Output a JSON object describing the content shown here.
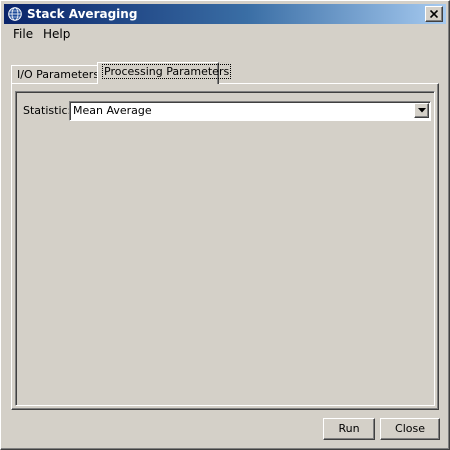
{
  "window": {
    "title": "Stack Averaging",
    "app_icon": "globe-icon",
    "close_icon": "close-icon"
  },
  "menu": {
    "file": "File",
    "help": "Help"
  },
  "tabs": [
    {
      "label": "I/O Parameters",
      "active": false
    },
    {
      "label": "Processing Parameters",
      "active": true
    }
  ],
  "processing": {
    "statistic_label": "Statistic:",
    "statistic_value": "Mean Average",
    "dropdown_icon": "chevron-down-icon"
  },
  "buttons": {
    "run": "Run",
    "close": "Close"
  },
  "colors": {
    "title_gradient_start": "#0a246a",
    "title_gradient_end": "#a6caf0",
    "face": "#d4d0c8"
  }
}
